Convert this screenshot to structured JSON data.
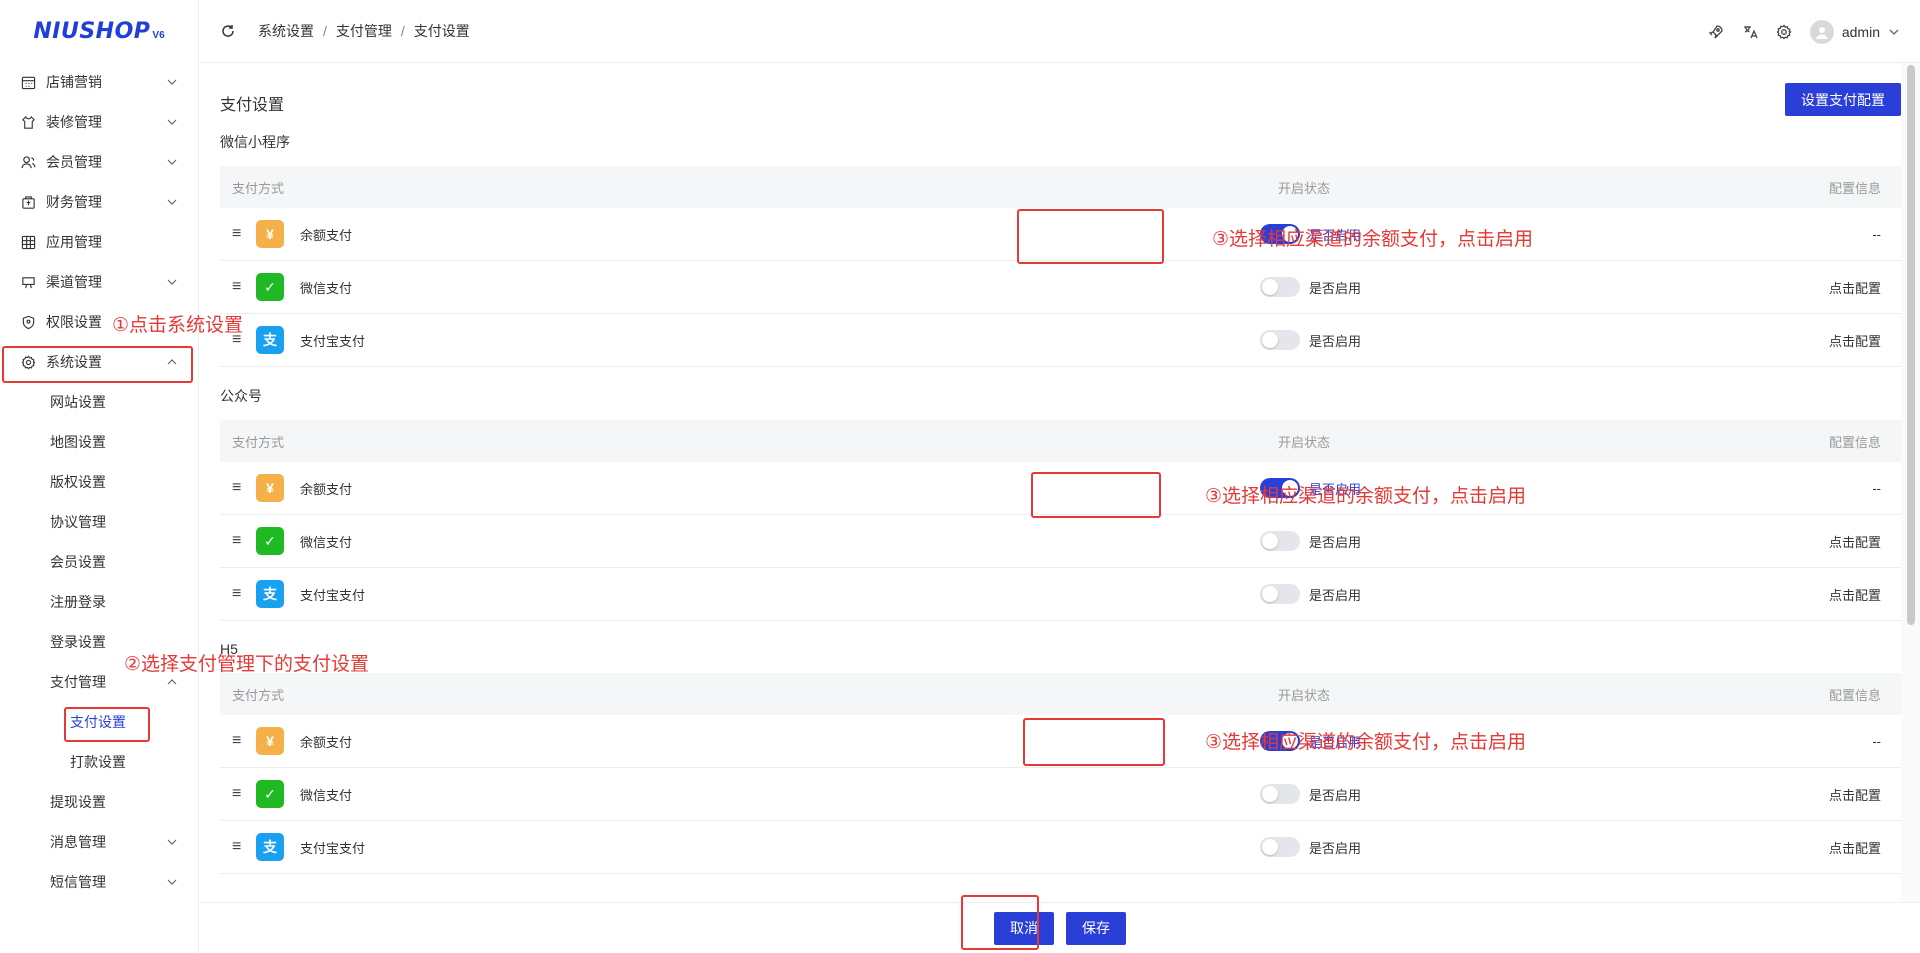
{
  "logo": {
    "text": "NIUSHOP",
    "version": "V6"
  },
  "sidebar": {
    "items": [
      {
        "label": "店铺营销",
        "icon": "calendar-icon",
        "arrow": "down"
      },
      {
        "label": "装修管理",
        "icon": "shirt-icon",
        "arrow": "down"
      },
      {
        "label": "会员管理",
        "icon": "user-icon",
        "arrow": "down"
      },
      {
        "label": "财务管理",
        "icon": "wallet-icon",
        "arrow": "down"
      },
      {
        "label": "应用管理",
        "icon": "grid-icon",
        "arrow": ""
      },
      {
        "label": "渠道管理",
        "icon": "channel-icon",
        "arrow": "down"
      },
      {
        "label": "权限设置",
        "icon": "shield-icon",
        "arrow": ""
      },
      {
        "label": "系统设置",
        "icon": "gear-icon",
        "arrow": "up"
      }
    ],
    "sub_items": [
      {
        "label": "网站设置"
      },
      {
        "label": "地图设置"
      },
      {
        "label": "版权设置"
      },
      {
        "label": "协议管理"
      },
      {
        "label": "会员设置"
      },
      {
        "label": "注册登录"
      },
      {
        "label": "登录设置"
      }
    ],
    "pay_manage": {
      "label": "支付管理"
    },
    "pay_sub": [
      {
        "label": "支付设置",
        "active": true
      },
      {
        "label": "打款设置",
        "active": false
      }
    ],
    "tail_items": [
      {
        "label": "提现设置",
        "arrow": ""
      },
      {
        "label": "消息管理",
        "arrow": "down"
      },
      {
        "label": "短信管理",
        "arrow": "down"
      }
    ]
  },
  "header": {
    "breadcrumb": [
      "系统设置",
      "支付管理",
      "支付设置"
    ],
    "separator": "/",
    "user": "admin"
  },
  "main": {
    "title": "支付设置",
    "config_button": "设置支付配置",
    "columns": {
      "method": "支付方式",
      "status": "开启状态",
      "config": "配置信息"
    },
    "sections": [
      {
        "title": "微信小程序",
        "rows": [
          {
            "name": "余额支付",
            "icon": "balance",
            "glyph": "¥",
            "enabled": true,
            "switch_label": "是否启用",
            "config": "--"
          },
          {
            "name": "微信支付",
            "icon": "wechat",
            "glyph": "✓",
            "enabled": false,
            "switch_label": "是否启用",
            "config": "点击配置"
          },
          {
            "name": "支付宝支付",
            "icon": "alipay",
            "glyph": "支",
            "enabled": false,
            "switch_label": "是否启用",
            "config": "点击配置"
          }
        ]
      },
      {
        "title": "公众号",
        "rows": [
          {
            "name": "余额支付",
            "icon": "balance",
            "glyph": "¥",
            "enabled": true,
            "switch_label": "是否启用",
            "config": "--"
          },
          {
            "name": "微信支付",
            "icon": "wechat",
            "glyph": "✓",
            "enabled": false,
            "switch_label": "是否启用",
            "config": "点击配置"
          },
          {
            "name": "支付宝支付",
            "icon": "alipay",
            "glyph": "支",
            "enabled": false,
            "switch_label": "是否启用",
            "config": "点击配置"
          }
        ]
      },
      {
        "title": "H5",
        "rows": [
          {
            "name": "余额支付",
            "icon": "balance",
            "glyph": "¥",
            "enabled": true,
            "switch_label": "是否启用",
            "config": "--"
          },
          {
            "name": "微信支付",
            "icon": "wechat",
            "glyph": "✓",
            "enabled": false,
            "switch_label": "是否启用",
            "config": "点击配置"
          },
          {
            "name": "支付宝支付",
            "icon": "alipay",
            "glyph": "支",
            "enabled": false,
            "switch_label": "是否启用",
            "config": "点击配置"
          }
        ]
      }
    ]
  },
  "footer": {
    "cancel": "取消",
    "save": "保存"
  },
  "annotations": {
    "step1": "①点击系统设置",
    "step2": "②选择支付管理下的支付设置",
    "step3": "③选择相应渠道的余额支付，点击启用"
  },
  "colors": {
    "accent": "#2a3fd8",
    "annotation": "#e53935"
  }
}
